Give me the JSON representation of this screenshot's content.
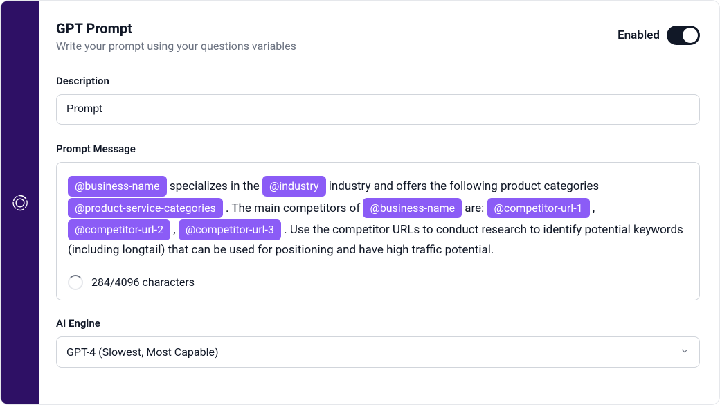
{
  "header": {
    "title": "GPT Prompt",
    "subtitle": "Write your prompt using your questions variables",
    "enabled_label": "Enabled"
  },
  "description": {
    "label": "Description",
    "value": "Prompt"
  },
  "prompt": {
    "label": "Prompt Message",
    "segments": [
      {
        "var": "@business-name"
      },
      {
        "text": " specializes in the "
      },
      {
        "var": "@industry"
      },
      {
        "text": " industry and offers the following product categories "
      },
      {
        "var": "@product-service-categories"
      },
      {
        "text": " . The main competitors of "
      },
      {
        "var": "@business-name"
      },
      {
        "text": " are: "
      },
      {
        "var": "@competitor-url-1"
      },
      {
        "text": " , "
      },
      {
        "var": "@competitor-url-2"
      },
      {
        "text": " , "
      },
      {
        "var": "@competitor-url-3"
      },
      {
        "text": " . Use the competitor URLs to conduct research to identify potential keywords (including longtail) that can be used for positioning and have high traffic potential."
      }
    ],
    "char_count": "284/4096 characters"
  },
  "engine": {
    "label": "AI Engine",
    "value": "GPT-4 (Slowest, Most Capable)"
  }
}
